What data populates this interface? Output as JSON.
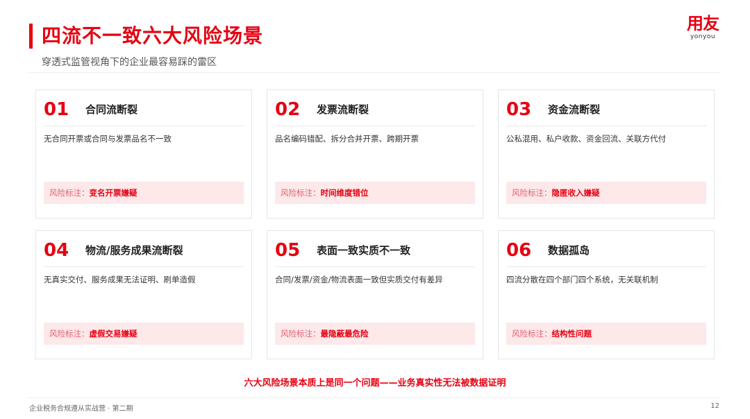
{
  "header": {
    "title": "四流不一致六大风险场景",
    "subtitle": "穿透式监管视角下的企业最容易踩的雷区"
  },
  "logo": {
    "main": "用友",
    "sub": "yonyou"
  },
  "cards": [
    {
      "num": "01",
      "title": "合同流断裂",
      "desc": "无合同开票或合同与发票品名不一致",
      "risk_label": "风险标注：",
      "risk_value": "变名开票嫌疑"
    },
    {
      "num": "02",
      "title": "发票流断裂",
      "desc": "品名编码错配、拆分合并开票、跨期开票",
      "risk_label": "风险标注：",
      "risk_value": "时间维度错位"
    },
    {
      "num": "03",
      "title": "资金流断裂",
      "desc": "公私混用、私户收款、资金回流、关联方代付",
      "risk_label": "风险标注：",
      "risk_value": "隐匿收入嫌疑"
    },
    {
      "num": "04",
      "title": "物流/服务成果流断裂",
      "desc": "无真实交付、服务成果无法证明、刷单造假",
      "risk_label": "风险标注：",
      "risk_value": "虚假交易嫌疑"
    },
    {
      "num": "05",
      "title": "表面一致实质不一致",
      "desc": "合同/发票/资金/物流表面一致但实质交付有差异",
      "risk_label": "风险标注：",
      "risk_value": "最隐蔽最危险"
    },
    {
      "num": "06",
      "title": "数据孤岛",
      "desc": "四流分散在四个部门四个系统，无关联机制",
      "risk_label": "风险标注：",
      "risk_value": "结构性问题"
    }
  ],
  "conclusion": "六大风险场景本质上是同一个问题——业务真实性无法被数据证明",
  "footer": {
    "left": "企业税务合规遵从实战营 · 第二期",
    "page": "12"
  },
  "colors": {
    "accent": "#e60012",
    "risk_bg": "#fde8ea"
  }
}
